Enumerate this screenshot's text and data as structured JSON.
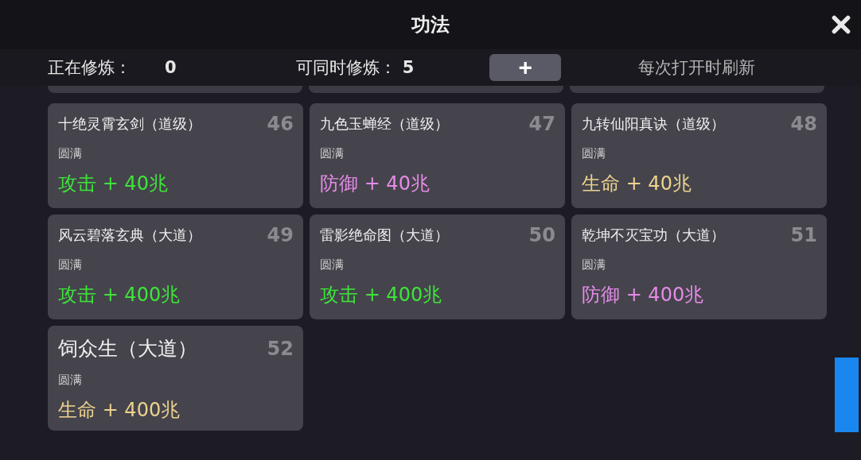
{
  "window": {
    "title": "功法"
  },
  "header": {
    "training_label": "正在修炼：",
    "training_count": "0",
    "capacity_label": "可同时修炼：",
    "capacity_count": "5",
    "add_button": "+",
    "refresh_note": "每次打开时刷新"
  },
  "cards": [
    {
      "name": "十绝灵霄玄剑（道级）",
      "number": "46",
      "status": "圆满",
      "bonus": "攻击 + 40兆",
      "kind": "attack"
    },
    {
      "name": "九色玉蝉经（道级）",
      "number": "47",
      "status": "圆满",
      "bonus": "防御 + 40兆",
      "kind": "defense"
    },
    {
      "name": "九转仙阳真诀（道级）",
      "number": "48",
      "status": "圆满",
      "bonus": "生命 + 40兆",
      "kind": "life"
    },
    {
      "name": "风云碧落玄典（大道）",
      "number": "49",
      "status": "圆满",
      "bonus": "攻击 + 400兆",
      "kind": "attack"
    },
    {
      "name": "雷影绝命图（大道）",
      "number": "50",
      "status": "圆满",
      "bonus": "攻击 + 400兆",
      "kind": "attack"
    },
    {
      "name": "乾坤不灭宝功（大道）",
      "number": "51",
      "status": "圆满",
      "bonus": "防御 + 400兆",
      "kind": "defense"
    },
    {
      "name": "饲众生（大道）",
      "number": "52",
      "status": "圆满",
      "bonus": "生命 + 400兆",
      "kind": "life"
    }
  ]
}
